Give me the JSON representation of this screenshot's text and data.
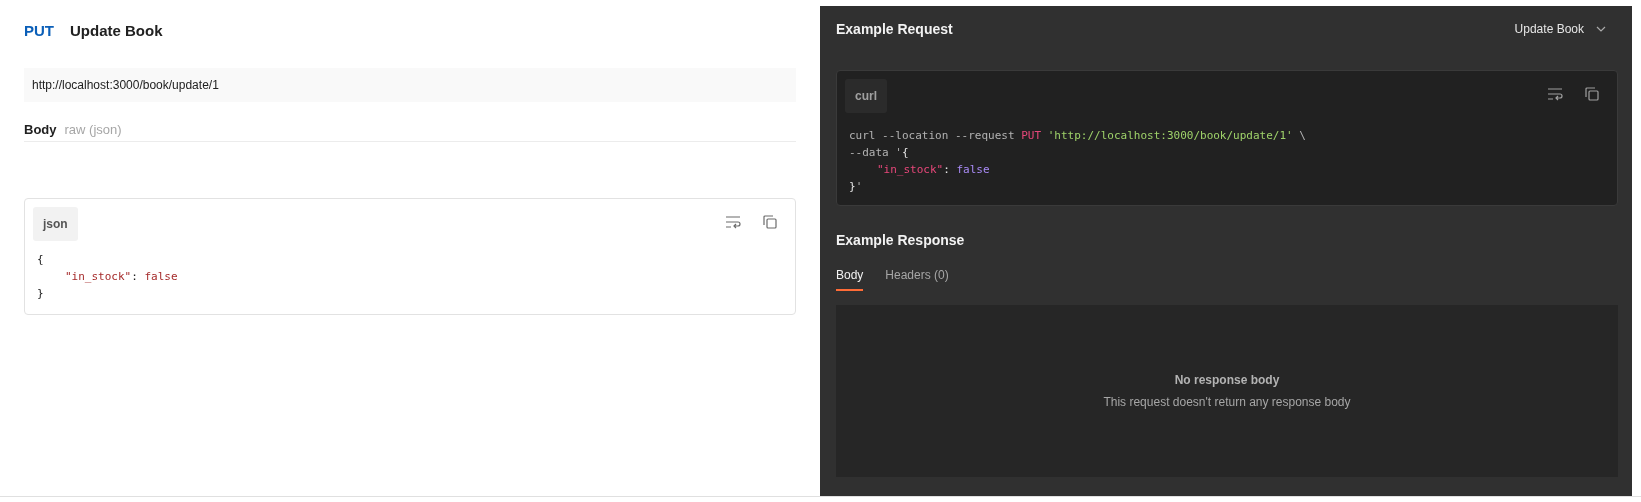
{
  "request": {
    "method": "PUT",
    "title": "Update Book",
    "url": "http://localhost:3000/book/update/1",
    "body": {
      "label": "Body",
      "mode": "raw (json)"
    },
    "code": {
      "language": "json",
      "lines": [
        {
          "indented": false,
          "tokens": [
            {
              "kind": "punct",
              "text": "{"
            }
          ]
        },
        {
          "indented": true,
          "tokens": [
            {
              "kind": "key",
              "text": "\"in_stock\""
            },
            {
              "kind": "punct",
              "text": ": "
            },
            {
              "kind": "literal",
              "text": "false"
            }
          ]
        },
        {
          "indented": false,
          "tokens": [
            {
              "kind": "punct",
              "text": "}"
            }
          ]
        }
      ]
    }
  },
  "example_request": {
    "title": "Example Request",
    "selector": "Update Book",
    "code": {
      "language": "curl",
      "lines": [
        {
          "indented": false,
          "tokens": [
            {
              "kind": "plain",
              "text": "curl --location --request "
            },
            {
              "kind": "keyword",
              "text": "PUT"
            },
            {
              "kind": "string",
              "text": " 'http://localhost:3000/book/update/1'"
            },
            {
              "kind": "plain",
              "text": " \\"
            }
          ]
        },
        {
          "indented": false,
          "tokens": [
            {
              "kind": "plain",
              "text": "--data '"
            },
            {
              "kind": "punct",
              "text": "{"
            }
          ]
        },
        {
          "indented": true,
          "tokens": [
            {
              "kind": "key",
              "text": "\"in_stock\""
            },
            {
              "kind": "punct",
              "text": ": "
            },
            {
              "kind": "literal",
              "text": "false"
            }
          ]
        },
        {
          "indented": false,
          "tokens": [
            {
              "kind": "punct",
              "text": "}"
            },
            {
              "kind": "plain",
              "text": "'"
            }
          ]
        }
      ]
    }
  },
  "example_response": {
    "title": "Example Response",
    "tabs": [
      {
        "label": "Body",
        "selected": true
      },
      {
        "label": "Headers (0)",
        "selected": false
      }
    ],
    "empty": {
      "title": "No response body",
      "message": "This request doesn't return any response body"
    }
  }
}
